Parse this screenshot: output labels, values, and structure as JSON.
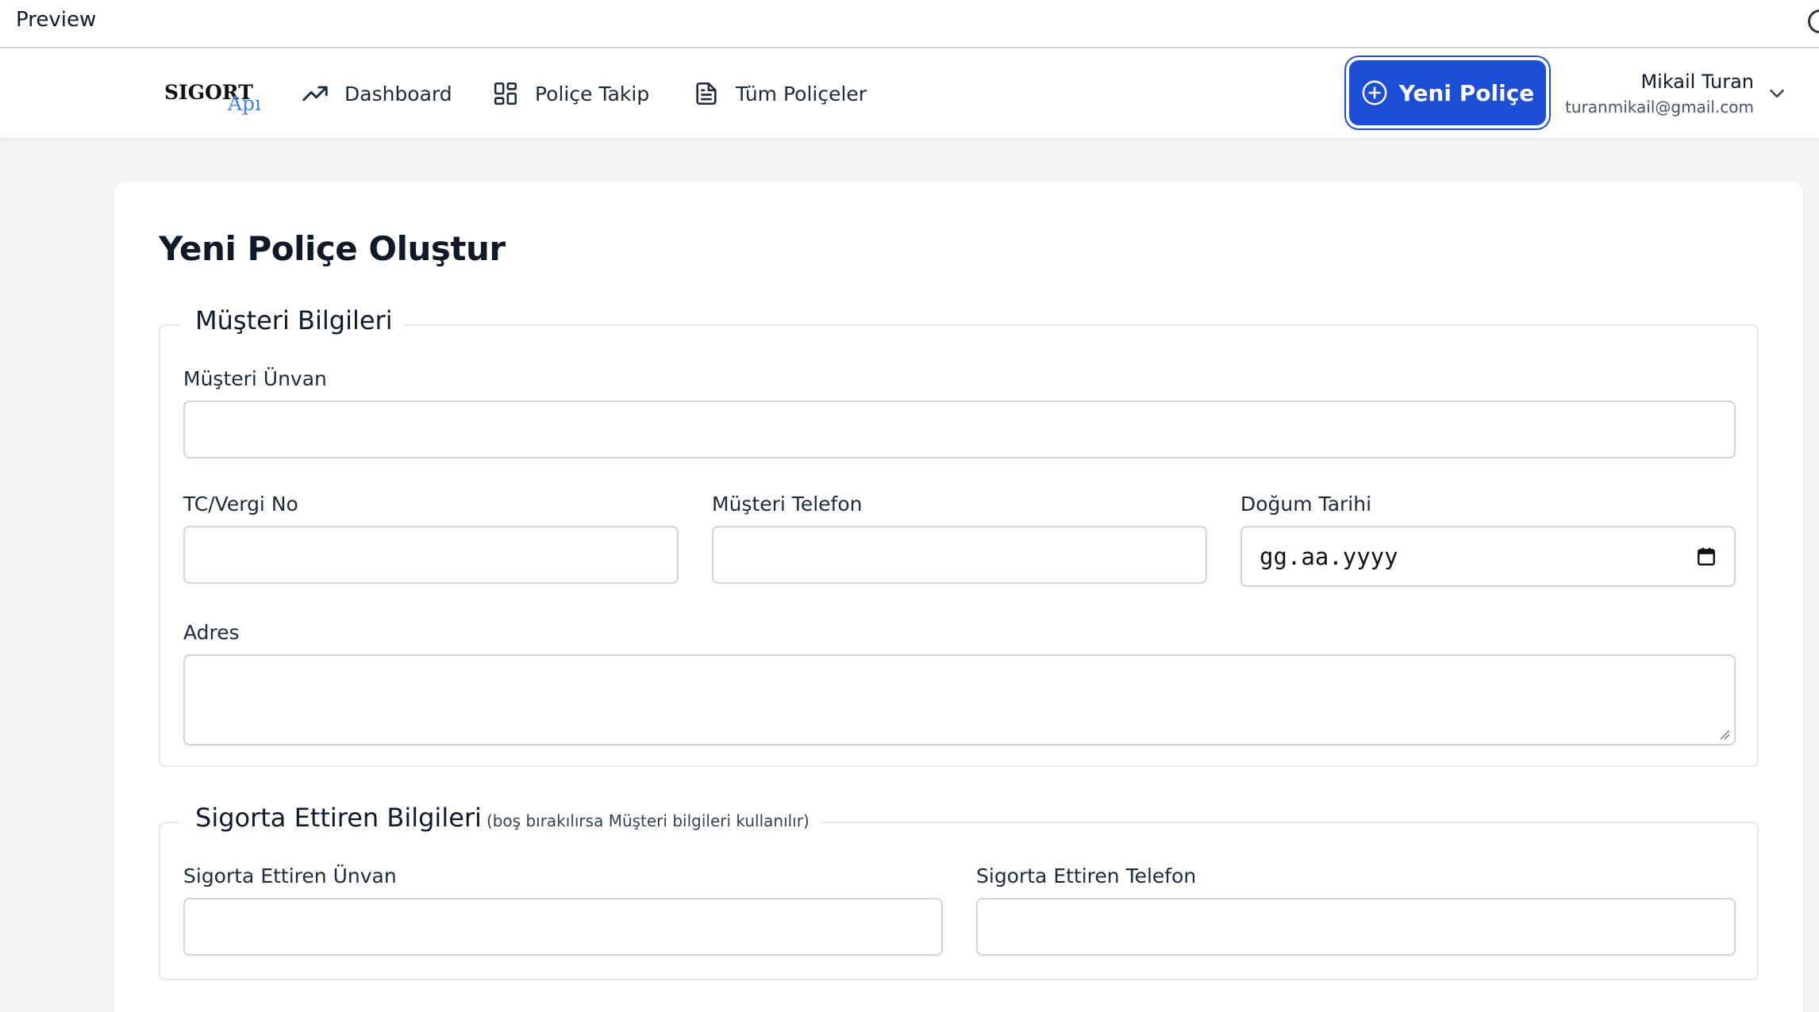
{
  "preview": {
    "title": "Preview"
  },
  "nav": {
    "logo_main": "SIGORT",
    "logo_t": "T",
    "logo_sub": "Apı",
    "links": [
      {
        "label": "Dashboard",
        "icon": "trending-up-icon"
      },
      {
        "label": "Poliçe Takip",
        "icon": "grid-icon"
      },
      {
        "label": "Tüm Poliçeler",
        "icon": "document-icon"
      }
    ],
    "new_button": {
      "label": "Yeni Poliçe",
      "icon": "plus-circle-icon"
    },
    "user": {
      "name": "Mikail Turan",
      "email": "turanmikail@gmail.com"
    }
  },
  "page": {
    "title": "Yeni Poliçe Oluştur"
  },
  "customer": {
    "legend": "Müşteri Bilgileri",
    "fields": {
      "unvan": {
        "label": "Müşteri Ünvan",
        "value": ""
      },
      "tc": {
        "label": "TC/Vergi No",
        "value": ""
      },
      "telefon": {
        "label": "Müşteri Telefon",
        "value": ""
      },
      "dogum": {
        "label": "Doğum Tarihi",
        "value": "gg.aa.yyyy"
      },
      "adres": {
        "label": "Adres",
        "value": ""
      }
    }
  },
  "insurer": {
    "legend": "Sigorta Ettiren Bilgileri",
    "legend_note": "(boş bırakılırsa Müşteri bilgileri kullanılır)",
    "fields": {
      "unvan": {
        "label": "Sigorta Ettiren Ünvan",
        "value": ""
      },
      "telefon": {
        "label": "Sigorta Ettiren Telefon",
        "value": ""
      }
    }
  },
  "colors": {
    "accent": "#1d4ed8",
    "background": "#f3f4f6"
  }
}
